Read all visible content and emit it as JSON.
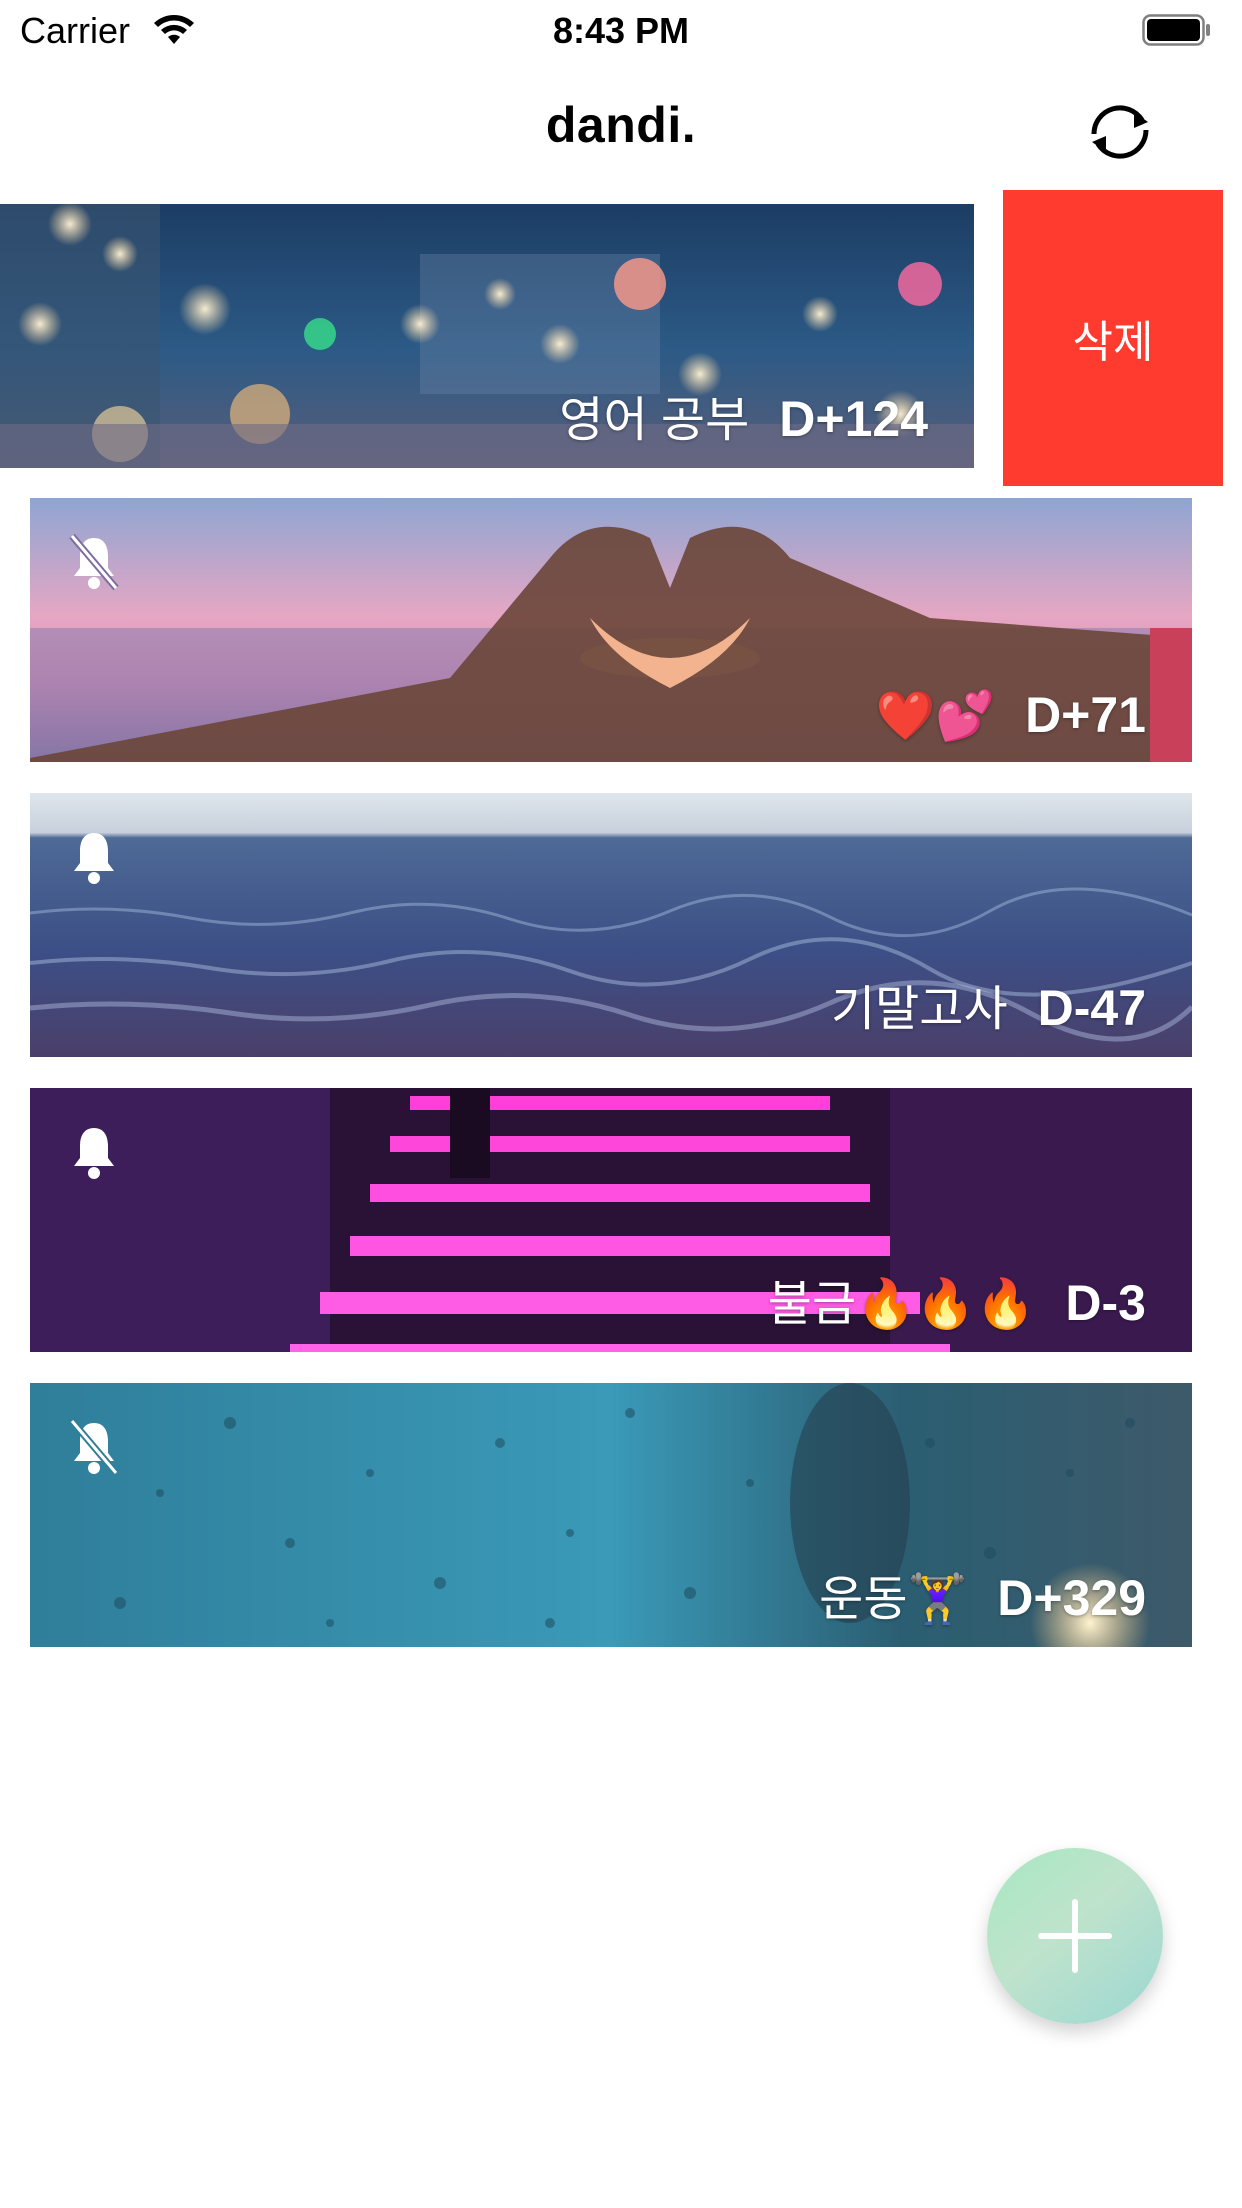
{
  "status_bar": {
    "carrier": "Carrier",
    "time": "8:43 PM"
  },
  "nav": {
    "title": "dandi.",
    "refresh_icon": "refresh-icon"
  },
  "swipe_action": {
    "delete_label": "삭제",
    "color": "#ff3b30"
  },
  "cards": [
    {
      "title": "영어 공부",
      "dday": "D+124",
      "notification": "none"
    },
    {
      "title": "❤️💕",
      "dday": "D+71",
      "notification": "off"
    },
    {
      "title": "기말고사",
      "dday": "D-47",
      "notification": "on"
    },
    {
      "title": "불금🔥🔥🔥",
      "dday": "D-3",
      "notification": "on"
    },
    {
      "title": "운동🏋️‍♀️",
      "dday": "D+329",
      "notification": "off"
    }
  ],
  "fab": {
    "icon": "plus-icon"
  }
}
